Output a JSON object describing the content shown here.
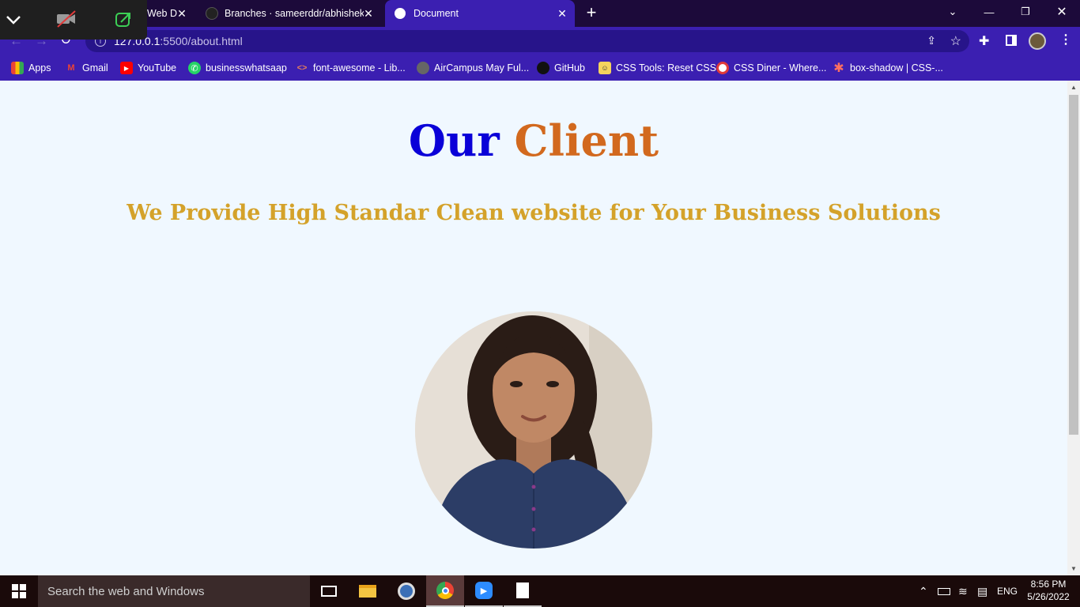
{
  "browser": {
    "tabs": [
      {
        "title": "Web D",
        "active": false
      },
      {
        "title": "Branches · sameerddr/abhishek-s",
        "active": false
      },
      {
        "title": "Document",
        "active": true
      }
    ],
    "new_tab": "+",
    "address": {
      "host": "127.0.0.1",
      "path": ":5500/about.html"
    },
    "bookmarks": [
      {
        "label": "Apps",
        "icon": "apps-grid-icon"
      },
      {
        "label": "Gmail",
        "icon": "gmail-icon"
      },
      {
        "label": "YouTube",
        "icon": "youtube-icon"
      },
      {
        "label": "businesswhatsaap",
        "icon": "whatsapp-icon"
      },
      {
        "label": "font-awesome - Lib...",
        "icon": "code-icon"
      },
      {
        "label": "AirCampus May Ful...",
        "icon": "globe-icon"
      },
      {
        "label": "GitHub",
        "icon": "github-icon"
      },
      {
        "label": "CSS Tools: Reset CSS",
        "icon": "css-tools-icon"
      },
      {
        "label": "CSS Diner - Where...",
        "icon": "css-diner-icon"
      },
      {
        "label": "box-shadow | CSS-...",
        "icon": "asterisk-icon"
      }
    ]
  },
  "page": {
    "title_part1": "Our",
    "title_part2": "Client",
    "subtitle": "We Provide High Standar Clean website for Your Business Solutions"
  },
  "taskbar": {
    "search_placeholder": "Search the web and Windows",
    "language": "ENG",
    "time": "8:56 PM",
    "date": "5/26/2022"
  },
  "colors": {
    "title_blue": "#0a00d8",
    "title_orange": "#d2691e",
    "subtitle_gold": "#d4a22a",
    "page_bg": "#f0f8ff",
    "browser_accent": "#3b1fb1"
  }
}
